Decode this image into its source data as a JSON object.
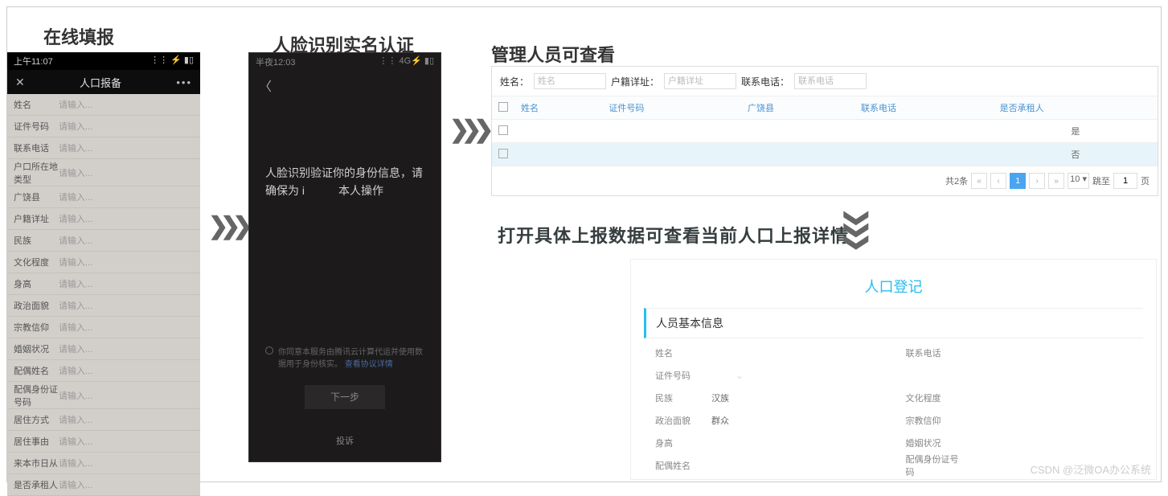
{
  "titles": {
    "t1": "在线填报",
    "t2": "人脸识别实名认证",
    "t3": "管理人员可查看",
    "t4": "打开具体上报数据可查看当前人口上报详情"
  },
  "phone1": {
    "time": "上午11:07",
    "signal": "⋮⋮ ⚡ ▮▯",
    "title": "人口报备",
    "close": "✕",
    "more": "•••",
    "fields": [
      {
        "label": "姓名",
        "val": "请输入..."
      },
      {
        "label": "证件号码",
        "val": "请输入..."
      },
      {
        "label": "联系电话",
        "val": "请输入..."
      },
      {
        "label": "户口所在地类型",
        "val": "请输入...",
        "tall": true
      },
      {
        "label": "广饶县",
        "val": "请输入..."
      },
      {
        "label": "户籍详址",
        "val": "请输入..."
      },
      {
        "label": "民族",
        "val": "请输入..."
      },
      {
        "label": "文化程度",
        "val": "请输入..."
      },
      {
        "label": "身高",
        "val": "请输入..."
      },
      {
        "label": "政治面貌",
        "val": "请输入..."
      },
      {
        "label": "宗教信仰",
        "val": "请输入..."
      },
      {
        "label": "婚姻状况",
        "val": "请输入..."
      },
      {
        "label": "配偶姓名",
        "val": "请输入..."
      },
      {
        "label": "配偶身份证号码",
        "val": "请输入...",
        "tall": true
      },
      {
        "label": "居住方式",
        "val": "请输入..."
      },
      {
        "label": "居住事由",
        "val": "请输入..."
      },
      {
        "label": "来本市日从",
        "val": "请输入..."
      },
      {
        "label": "是否承租人",
        "val": "请输入..."
      }
    ]
  },
  "phone2": {
    "time": "半夜12:03",
    "signal": "⋮⋮ 4G⚡ ▮▯",
    "back": "〈",
    "message": "人脸识别验证你的身份信息，请确保为 i　　　本人操作",
    "consent_pre": "你同意本服务由腾讯云计算代运并使用数据用于身份核实。",
    "consent_link": "查看协议详情",
    "next_btn": "下一步",
    "bottom": "投诉"
  },
  "admin": {
    "filters": [
      {
        "label": "姓名：",
        "ph": "姓名"
      },
      {
        "label": "户籍详址：",
        "ph": "户籍详址"
      },
      {
        "label": "联系电话：",
        "ph": "联系电话"
      }
    ],
    "headers": [
      "",
      "姓名",
      "证件号码",
      "广饶县",
      "联系电话",
      "是否承租人"
    ],
    "rows": [
      {
        "tenant": "是"
      },
      {
        "tenant": "否",
        "highlight": true
      }
    ],
    "pagination": {
      "total_label": "共2条",
      "first": "«",
      "prev": "‹",
      "page": "1",
      "next": "›",
      "last": "»",
      "size_options": "10 ▾",
      "jump_label": "跳至",
      "jump_val": "1",
      "jump_suffix": "页"
    }
  },
  "detail": {
    "title": "人口登记",
    "section": "人员基本信息",
    "fields": [
      {
        "label": "姓名",
        "value": ""
      },
      {
        "label": "联系电话",
        "value": ""
      },
      {
        "label": "证件号码",
        "value": "",
        "chevron": true
      },
      {
        "label": "",
        "value": ""
      },
      {
        "label": "民族",
        "value": "汉族"
      },
      {
        "label": "文化程度",
        "value": ""
      },
      {
        "label": "政治面貌",
        "value": "群众"
      },
      {
        "label": "宗教信仰",
        "value": ""
      },
      {
        "label": "身高",
        "value": ""
      },
      {
        "label": "婚姻状况",
        "value": ""
      },
      {
        "label": "配偶姓名",
        "value": ""
      },
      {
        "label": "配偶身份证号码",
        "value": ""
      }
    ]
  },
  "watermark": "CSDN @泛微OA办公系统"
}
